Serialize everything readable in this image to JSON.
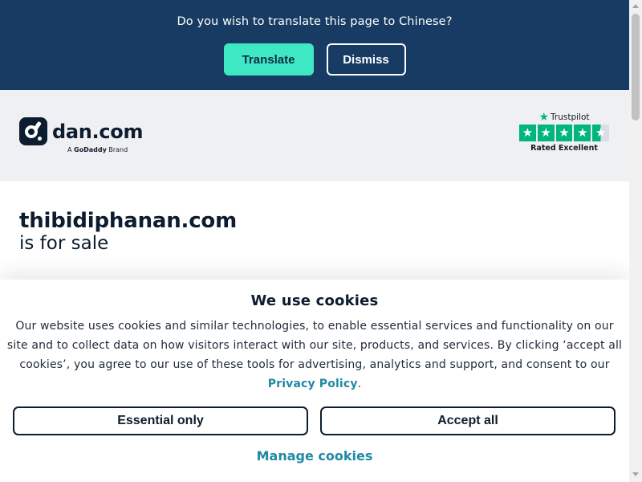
{
  "translate_bar": {
    "question": "Do you wish to translate this page to Chinese?",
    "translate_label": "Translate",
    "dismiss_label": "Dismiss"
  },
  "header": {
    "logo_text": "dan.com",
    "logo_sub_prefix": "A",
    "logo_sub_brand": "GoDaddy",
    "logo_sub_suffix": "Brand",
    "trustpilot": {
      "label": "Trustpilot",
      "rating_text": "Rated Excellent",
      "stars": 4.5
    }
  },
  "main": {
    "domain": "thibidiphanan.com",
    "status": "is for sale"
  },
  "cookie_banner": {
    "title": "We use cookies",
    "body": "Our website uses cookies and similar technologies, to enable essential services and functionality on our site and to collect data on how visitors interact with our site, products, and services. By clicking ‘accept all cookies’, you agree to our use of these tools for advertising, analytics and support, and consent to our ",
    "privacy_link": "Privacy Policy",
    "body_end": ".",
    "essential_label": "Essential only",
    "accept_label": "Accept all",
    "manage_label": "Manage cookies"
  },
  "colors": {
    "translate_bar_bg": "#173b63",
    "translate_button": "#3ee8c3",
    "header_bg": "#eef0f3",
    "trustpilot_green": "#00b67a",
    "link_teal": "#1f8aa5",
    "brand_dark": "#0d1c2e"
  },
  "icons": {
    "logo": "dan-logo-icon",
    "trustpilot_star": "star-icon"
  }
}
